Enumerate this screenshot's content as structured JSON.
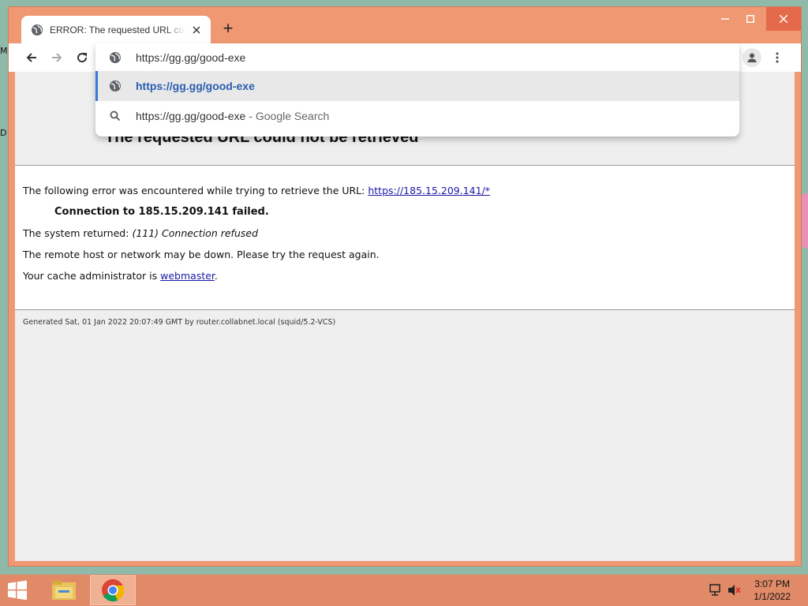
{
  "browser": {
    "tab": {
      "title": "ERROR: The requested URL could not be retrieved",
      "favicon": "globe-icon"
    },
    "new_tab_label": "+",
    "window_controls": [
      "minimize-icon",
      "maximize-icon",
      "close-icon"
    ],
    "nav_icons": [
      "back-arrow-icon",
      "forward-arrow-icon",
      "reload-icon"
    ],
    "omnibox": {
      "value": "https://gg.gg/good-exe",
      "suggestions": [
        {
          "text": "https://gg.gg/good-exe",
          "icon": "globe-icon",
          "selected": true
        },
        {
          "text": "https://gg.gg/good-exe",
          "hint": "- Google Search",
          "icon": "search-icon"
        }
      ]
    },
    "accent_color": "#ef9872"
  },
  "page": {
    "heading": "The requested URL could not be retrieved",
    "line1_prefix": "The following error was encountered while trying to retrieve the URL:",
    "line1_link": "https://185.15.209.141/*",
    "failure": "Connection to 185.15.209.141 failed.",
    "system_prefix": "The system returned:",
    "system_value": "(111) Connection refused",
    "remote_line": "The remote host or network may be down. Please try the request again.",
    "admin_prefix": "Your cache administrator is",
    "admin_link": "webmaster",
    "admin_suffix": ".",
    "footer": "Generated Sat, 01 Jan 2022 20:07:49 GMT by router.collabnet.local (squid/5.2-VCS)"
  },
  "desktop": {
    "edge_letters": [
      "M",
      "D"
    ]
  },
  "taskbar": {
    "apps": [
      "file-explorer-icon",
      "chrome-icon"
    ],
    "time": "3:07 PM",
    "date": "1/1/2022"
  }
}
